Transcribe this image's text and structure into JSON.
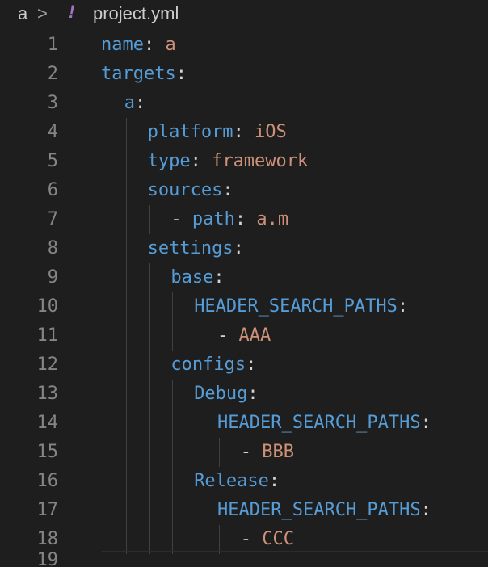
{
  "breadcrumb": {
    "folder": "a",
    "separator": ">",
    "file_icon": "yaml-exclamation-icon",
    "file_icon_glyph": "!",
    "file": "project.yml"
  },
  "colors": {
    "background": "#1e1e1e",
    "key": "#569cd6",
    "string_value": "#ce9178",
    "line_number": "#858585"
  },
  "editor": {
    "lines": [
      {
        "num": "1",
        "indent": 0,
        "dash": "",
        "key": "name",
        "colon": ":",
        "value": " a"
      },
      {
        "num": "2",
        "indent": 0,
        "dash": "",
        "key": "targets",
        "colon": ":",
        "value": ""
      },
      {
        "num": "3",
        "indent": 1,
        "dash": "",
        "key": "a",
        "colon": ":",
        "value": ""
      },
      {
        "num": "4",
        "indent": 2,
        "dash": "",
        "key": "platform",
        "colon": ":",
        "value": " iOS"
      },
      {
        "num": "5",
        "indent": 2,
        "dash": "",
        "key": "type",
        "colon": ":",
        "value": " framework"
      },
      {
        "num": "6",
        "indent": 2,
        "dash": "",
        "key": "sources",
        "colon": ":",
        "value": ""
      },
      {
        "num": "7",
        "indent": 3,
        "dash": "- ",
        "key": "path",
        "colon": ":",
        "value": " a.m"
      },
      {
        "num": "8",
        "indent": 2,
        "dash": "",
        "key": "settings",
        "colon": ":",
        "value": ""
      },
      {
        "num": "9",
        "indent": 3,
        "dash": "",
        "key": "base",
        "colon": ":",
        "value": ""
      },
      {
        "num": "10",
        "indent": 4,
        "dash": "",
        "key": "HEADER_SEARCH_PATHS",
        "colon": ":",
        "value": ""
      },
      {
        "num": "11",
        "indent": 5,
        "dash": "- ",
        "key": "",
        "colon": "",
        "value": "AAA"
      },
      {
        "num": "12",
        "indent": 3,
        "dash": "",
        "key": "configs",
        "colon": ":",
        "value": ""
      },
      {
        "num": "13",
        "indent": 4,
        "dash": "",
        "key": "Debug",
        "colon": ":",
        "value": ""
      },
      {
        "num": "14",
        "indent": 5,
        "dash": "",
        "key": "HEADER_SEARCH_PATHS",
        "colon": ":",
        "value": ""
      },
      {
        "num": "15",
        "indent": 6,
        "dash": "- ",
        "key": "",
        "colon": "",
        "value": "BBB"
      },
      {
        "num": "16",
        "indent": 4,
        "dash": "",
        "key": "Release",
        "colon": ":",
        "value": ""
      },
      {
        "num": "17",
        "indent": 5,
        "dash": "",
        "key": "HEADER_SEARCH_PATHS",
        "colon": ":",
        "value": ""
      },
      {
        "num": "18",
        "indent": 6,
        "dash": "- ",
        "key": "",
        "colon": "",
        "value": "CCC"
      },
      {
        "num": "19",
        "indent": 0,
        "dash": "",
        "key": "",
        "colon": "",
        "value": ""
      }
    ]
  }
}
